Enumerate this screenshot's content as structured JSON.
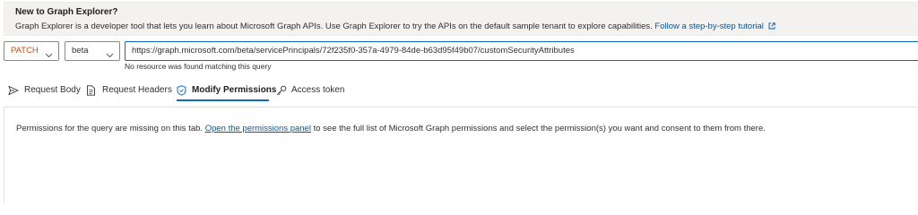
{
  "banner": {
    "title": "New to Graph Explorer?",
    "text": "Graph Explorer is a developer tool that lets you learn about Microsoft Graph APIs. Use Graph Explorer to try the APIs on the default sample tenant to explore capabilities.",
    "link_label": "Follow a step-by-step tutorial"
  },
  "query": {
    "method": "PATCH",
    "version": "beta",
    "url": "https://graph.microsoft.com/beta/servicePrincipals/72f235f0-357a-4979-84de-b63d95f49b07/customSecurityAttributes",
    "error": "No resource was found matching this query"
  },
  "tabs": [
    {
      "label": "Request Body",
      "icon": "send-icon"
    },
    {
      "label": "Request Headers",
      "icon": "document-icon"
    },
    {
      "label": "Modify Permissions",
      "icon": "shield-icon",
      "active": true
    },
    {
      "label": "Access token",
      "icon": "key-icon"
    }
  ],
  "permissions_panel": {
    "text_before": "Permissions for the query are missing on this tab.",
    "link_label": "Open the permissions panel",
    "text_after": "to see the full list of Microsoft Graph permissions and select the permission(s) you want and consent to them from there."
  },
  "colors": {
    "accent": "#0f6cbd",
    "link": "#005a9e",
    "method_patch": "#ca5010",
    "banner_bg": "#f3f2f1"
  }
}
